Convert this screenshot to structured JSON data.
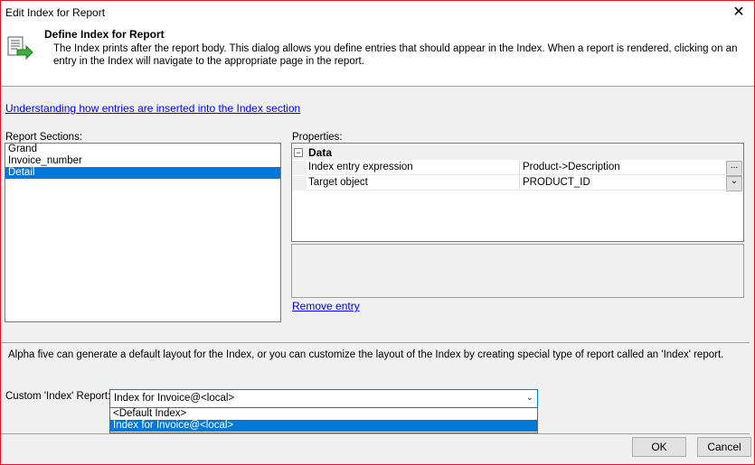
{
  "window": {
    "title": "Edit Index for Report",
    "close_glyph": "✕"
  },
  "header": {
    "title": "Define Index for Report",
    "description": "The Index prints after the report body.  This dialog allows you define entries that should appear in the Index. When a report is rendered, clicking on an entry in the Index will navigate to the appropriate page in the report.",
    "icon": "index-arrow-icon"
  },
  "help_link": "Understanding how entries are inserted into the Index section",
  "sections": {
    "label": "Report Sections:",
    "items": [
      "Grand",
      "Invoice_number",
      "Detail"
    ],
    "selected_index": 2
  },
  "properties": {
    "label": "Properties:",
    "category": "Data",
    "collapse_glyph": "−",
    "rows": [
      {
        "name": "Index entry expression",
        "value": "Product->Description",
        "button": "..."
      },
      {
        "name": "Target object",
        "value": "PRODUCT_ID",
        "button": "⌄"
      }
    ]
  },
  "remove_entry_link": "Remove entry",
  "info_text": "Alpha five can generate a default layout for the Index, or you can customize the layout of the Index by creating special type of report called an 'Index' report.",
  "custom_index": {
    "label": "Custom 'Index' Report:",
    "value": "Index for Invoice@<local>",
    "arrow": "⌄",
    "options": [
      "<Default Index>",
      "Index for Invoice@<local>"
    ],
    "selected_option": 1
  },
  "buttons": {
    "ok": "OK",
    "cancel": "Cancel"
  },
  "colors": {
    "selection": "#0078d7",
    "link": "#0000ee",
    "window_border": "#e81123"
  }
}
